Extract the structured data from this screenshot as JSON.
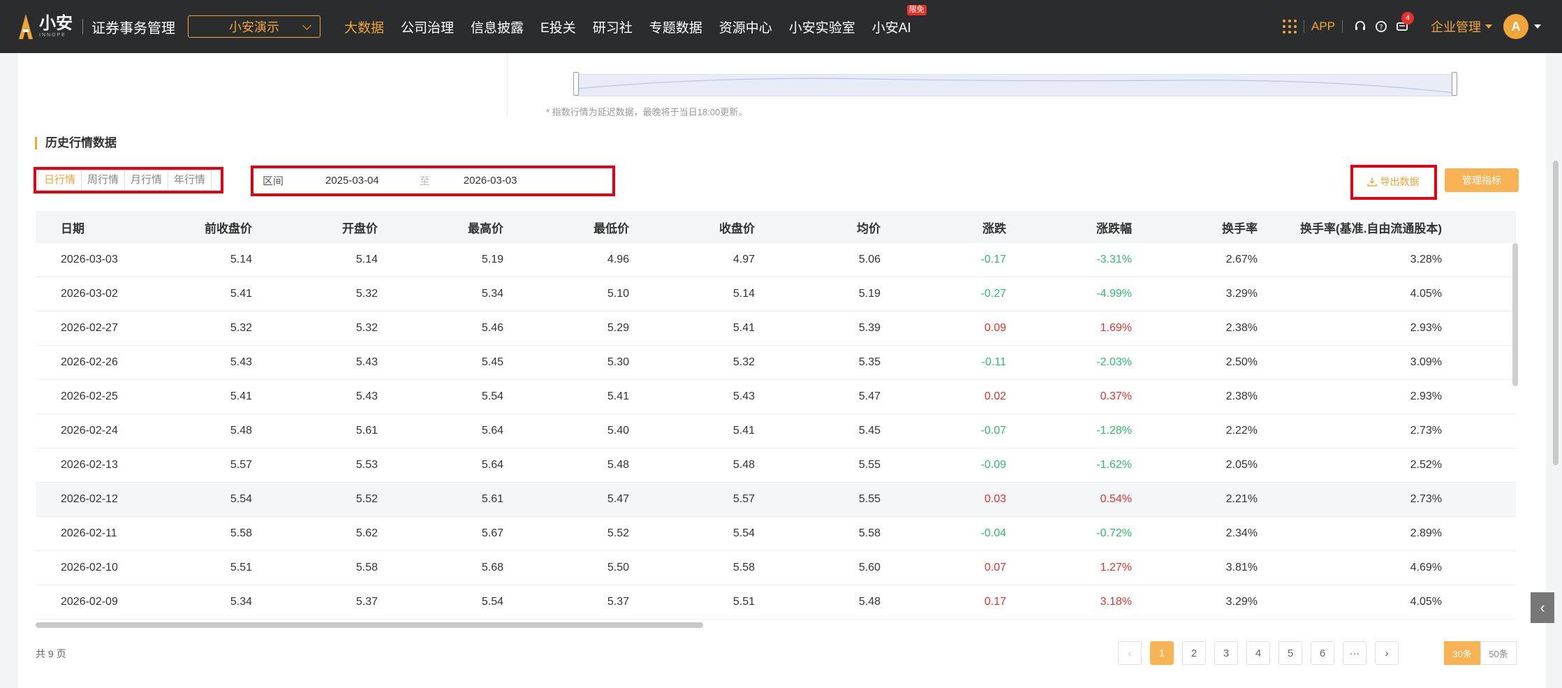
{
  "header": {
    "logo_text": "小安",
    "logo_sub": "INNOPE",
    "app_title": "证券事务管理",
    "org_select": "小安演示",
    "nav": [
      {
        "label": "大数据",
        "active": true
      },
      {
        "label": "公司治理"
      },
      {
        "label": "信息披露"
      },
      {
        "label": "E投关"
      },
      {
        "label": "研习社"
      },
      {
        "label": "专题数据"
      },
      {
        "label": "资源中心"
      },
      {
        "label": "小安实验室"
      },
      {
        "label": "小安AI",
        "badge": "限免"
      }
    ],
    "app_link": "APP",
    "message_count": "4",
    "enterprise_menu": "企业管理",
    "avatar_letter": "A"
  },
  "chart_note": "* 指数行情为延迟数据，最晚将于当日18:00更新。",
  "section_title": "历史行情数据",
  "tabs": [
    "日行情",
    "周行情",
    "月行情",
    "年行情"
  ],
  "range": {
    "label": "区间",
    "start": "2025-03-04",
    "sep": "至",
    "end": "2026-03-03"
  },
  "buttons": {
    "export": "导出数据",
    "manage": "管理指标"
  },
  "table": {
    "headers": [
      "日期",
      "前收盘价",
      "开盘价",
      "最高价",
      "最低价",
      "收盘价",
      "均价",
      "涨跌",
      "涨跌幅",
      "换手率",
      "换手率(基准.自由流通股本)"
    ],
    "rows": [
      [
        "2026-03-03",
        "5.14",
        "5.14",
        "5.19",
        "4.96",
        "4.97",
        "5.06",
        "-0.17",
        "-3.31%",
        "2.67%",
        "3.28%"
      ],
      [
        "2026-03-02",
        "5.41",
        "5.32",
        "5.34",
        "5.10",
        "5.14",
        "5.19",
        "-0.27",
        "-4.99%",
        "3.29%",
        "4.05%"
      ],
      [
        "2026-02-27",
        "5.32",
        "5.32",
        "5.46",
        "5.29",
        "5.41",
        "5.39",
        "0.09",
        "1.69%",
        "2.38%",
        "2.93%"
      ],
      [
        "2026-02-26",
        "5.43",
        "5.43",
        "5.45",
        "5.30",
        "5.32",
        "5.35",
        "-0.11",
        "-2.03%",
        "2.50%",
        "3.09%"
      ],
      [
        "2026-02-25",
        "5.41",
        "5.43",
        "5.54",
        "5.41",
        "5.43",
        "5.47",
        "0.02",
        "0.37%",
        "2.38%",
        "2.93%"
      ],
      [
        "2026-02-24",
        "5.48",
        "5.61",
        "5.64",
        "5.40",
        "5.41",
        "5.45",
        "-0.07",
        "-1.28%",
        "2.22%",
        "2.73%"
      ],
      [
        "2026-02-13",
        "5.57",
        "5.53",
        "5.64",
        "5.48",
        "5.48",
        "5.55",
        "-0.09",
        "-1.62%",
        "2.05%",
        "2.52%"
      ],
      [
        "2026-02-12",
        "5.54",
        "5.52",
        "5.61",
        "5.47",
        "5.57",
        "5.55",
        "0.03",
        "0.54%",
        "2.21%",
        "2.73%"
      ],
      [
        "2026-02-11",
        "5.58",
        "5.62",
        "5.67",
        "5.52",
        "5.54",
        "5.58",
        "-0.04",
        "-0.72%",
        "2.34%",
        "2.89%"
      ],
      [
        "2026-02-10",
        "5.51",
        "5.58",
        "5.68",
        "5.50",
        "5.58",
        "5.60",
        "0.07",
        "1.27%",
        "3.81%",
        "4.69%"
      ],
      [
        "2026-02-09",
        "5.34",
        "5.37",
        "5.54",
        "5.37",
        "5.51",
        "5.48",
        "0.17",
        "3.18%",
        "3.29%",
        "4.05%"
      ]
    ]
  },
  "footer": {
    "total": "共 9 页",
    "pages": [
      "1",
      "2",
      "3",
      "4",
      "5",
      "6",
      "···"
    ],
    "current_page": "1",
    "page_sizes": [
      "30条",
      "50条"
    ]
  },
  "colors": {
    "accent": "#f0a53b",
    "up": "#e5322d",
    "down": "#2cbd6e",
    "highlight_box": "#e50012"
  }
}
